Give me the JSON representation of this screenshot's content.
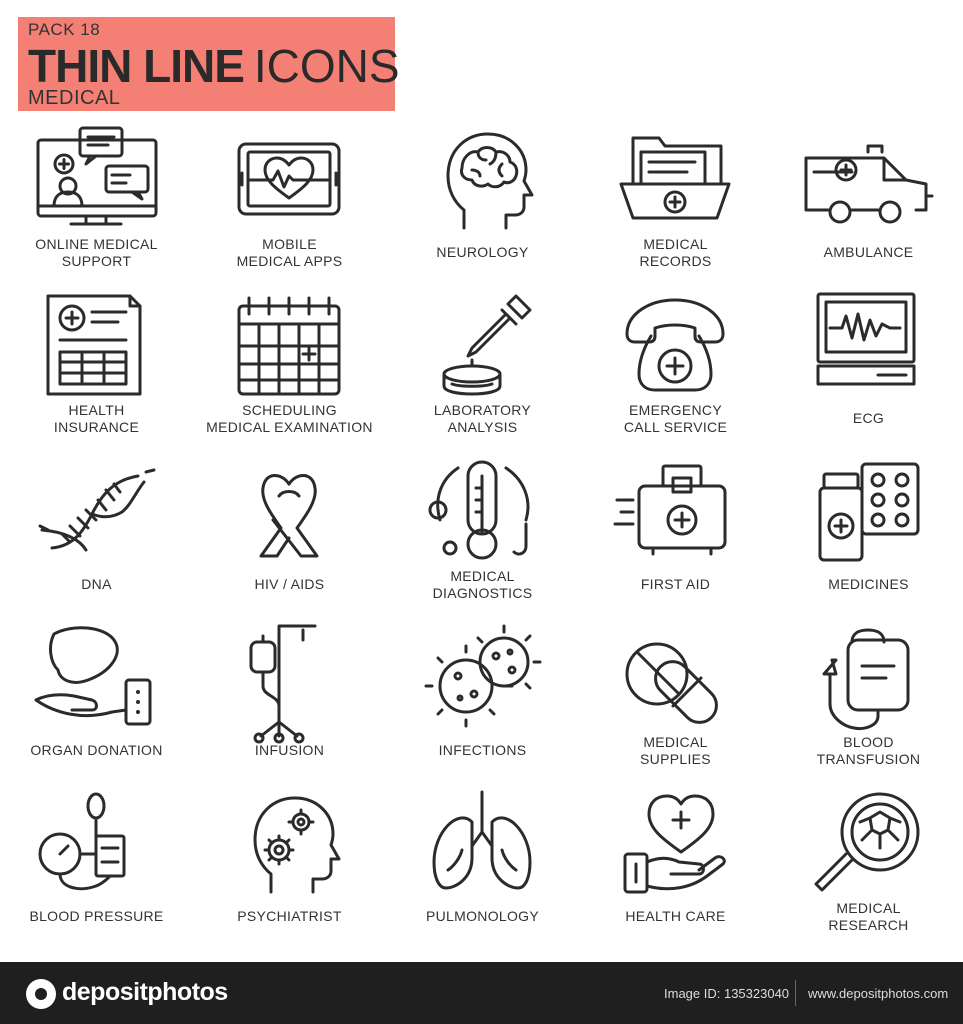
{
  "header": {
    "pack": "PACK 18",
    "title_bold": "THIN LINE",
    "title_light": "ICONS",
    "category": "MEDICAL",
    "banner_color": "#f47f75"
  },
  "icons": [
    {
      "id": "online-medical-support",
      "icon": "monitor-chat-icon",
      "lines": [
        "ONLINE MEDICAL",
        "SUPPORT"
      ]
    },
    {
      "id": "mobile-medical-apps",
      "icon": "tablet-heartbeat-icon",
      "lines": [
        "MOBILE",
        "MEDICAL APPS"
      ]
    },
    {
      "id": "neurology",
      "icon": "head-brain-icon",
      "lines": [
        "NEUROLOGY"
      ]
    },
    {
      "id": "medical-records",
      "icon": "folder-cross-icon",
      "lines": [
        "MEDICAL",
        "RECORDS"
      ]
    },
    {
      "id": "ambulance",
      "icon": "ambulance-icon",
      "lines": [
        "AMBULANCE"
      ]
    },
    {
      "id": "health-insurance",
      "icon": "insurance-document-icon",
      "lines": [
        "HEALTH",
        "INSURANCE"
      ]
    },
    {
      "id": "scheduling-medical-examination",
      "icon": "calendar-icon",
      "lines": [
        "SCHEDULING",
        "MEDICAL EXAMINATION"
      ]
    },
    {
      "id": "laboratory-analysis",
      "icon": "pipette-dish-icon",
      "lines": [
        "LABORATORY",
        "ANALYSIS"
      ]
    },
    {
      "id": "emergency-call-service",
      "icon": "telephone-cross-icon",
      "lines": [
        "EMERGENCY",
        "CALL SERVICE"
      ]
    },
    {
      "id": "ecg",
      "icon": "ecg-monitor-icon",
      "lines": [
        "ECG"
      ]
    },
    {
      "id": "dna",
      "icon": "dna-helix-icon",
      "lines": [
        "DNA"
      ]
    },
    {
      "id": "hiv-aids",
      "icon": "awareness-ribbon-icon",
      "lines": [
        "HIV / AIDS"
      ]
    },
    {
      "id": "medical-diagnostics",
      "icon": "thermometer-stethoscope-icon",
      "lines": [
        "MEDICAL",
        "DIAGNOSTICS"
      ]
    },
    {
      "id": "first-aid",
      "icon": "first-aid-kit-icon",
      "lines": [
        "FIRST AID"
      ]
    },
    {
      "id": "medicines",
      "icon": "pill-bottle-blister-icon",
      "lines": [
        "MEDICINES"
      ]
    },
    {
      "id": "organ-donation",
      "icon": "hand-liver-icon",
      "lines": [
        "ORGAN DONATION"
      ]
    },
    {
      "id": "infusion",
      "icon": "iv-stand-icon",
      "lines": [
        "INFUSION"
      ]
    },
    {
      "id": "infections",
      "icon": "virus-icon",
      "lines": [
        "INFECTIONS"
      ]
    },
    {
      "id": "medical-supplies",
      "icon": "pills-icon",
      "lines": [
        "MEDICAL",
        "SUPPLIES"
      ]
    },
    {
      "id": "blood-transfusion",
      "icon": "blood-bag-icon",
      "lines": [
        "BLOOD",
        "TRANSFUSION"
      ]
    },
    {
      "id": "blood-pressure",
      "icon": "tonometer-icon",
      "lines": [
        "BLOOD PRESSURE"
      ]
    },
    {
      "id": "psychiatrist",
      "icon": "head-gears-icon",
      "lines": [
        "PSYCHIATRIST"
      ]
    },
    {
      "id": "pulmonology",
      "icon": "lungs-icon",
      "lines": [
        "PULMONOLOGY"
      ]
    },
    {
      "id": "health-care",
      "icon": "hand-heart-icon",
      "lines": [
        "HEALTH CARE"
      ]
    },
    {
      "id": "medical-research",
      "icon": "magnifier-cell-icon",
      "lines": [
        "MEDICAL",
        "RESEARCH"
      ]
    }
  ],
  "footer": {
    "brand": "depositphotos",
    "image_id": "Image ID: 135323040",
    "url": "www.depositphotos.com"
  }
}
